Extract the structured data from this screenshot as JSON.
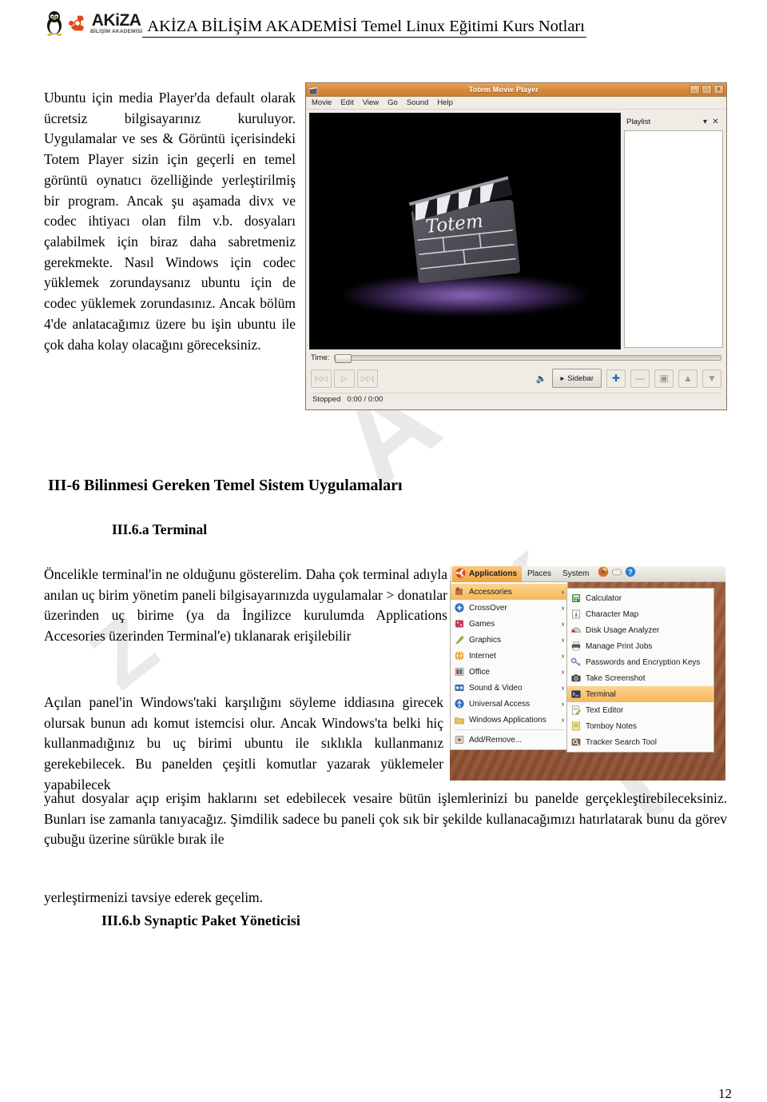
{
  "header": {
    "logo": {
      "tux_icon": "tux-penguin-icon",
      "ubuntu_icon": "ubuntu-logo-icon",
      "brand": "AKiZA",
      "brand_sub": "BİLİŞİM AKADEMİSİ"
    },
    "title": "AKİZA BİLİŞİM AKADEMİSİ Temel Linux Eğitimi Kurs Notları"
  },
  "intro_paragraph": "Ubuntu için media Player'da default olarak ücretsiz bilgisayarınız kuruluyor. Uygulamalar ve ses & Görüntü içerisindeki Totem Player sizin için geçerli en temel görüntü oynatıcı özelliğinde yerleştirilmiş bir program. Ancak şu aşamada divx ve codec ihtiyacı olan film v.b. dosyaları çalabilmek için biraz daha sabretmeniz gerekmekte. Nasıl Windows için codec yüklemek zorundaysanız ubuntu için de codec yüklemek zorundasınız. Ancak bölüm 4'de anlatacağımız üzere bu işin ubuntu ile çok daha kolay olacağını göreceksiniz.",
  "totem": {
    "window_title": "Totem Movie Player",
    "app_icon": "totem-app-icon",
    "window_buttons": [
      {
        "name": "minimize-button",
        "glyph": "_"
      },
      {
        "name": "maximize-button",
        "glyph": "□"
      },
      {
        "name": "close-button",
        "glyph": "x"
      }
    ],
    "menus": [
      "Movie",
      "Edit",
      "View",
      "Go",
      "Sound",
      "Help"
    ],
    "video_logo_text": "Totem",
    "playlist": {
      "title": "Playlist",
      "collapse_icon": "chevron-down-icon",
      "close_icon": "close-icon",
      "items": []
    },
    "time_label": "Time:",
    "controls": [
      {
        "name": "previous-button",
        "glyph": "|◁◁"
      },
      {
        "name": "play-button",
        "glyph": "▷"
      },
      {
        "name": "next-button",
        "glyph": "▷▷|"
      }
    ],
    "volume_icon": "volume-icon",
    "sidebar_button": "Sidebar",
    "playlist_buttons": [
      {
        "name": "add-to-playlist-button",
        "glyph": "✚"
      },
      {
        "name": "remove-from-playlist-button",
        "glyph": "—"
      },
      {
        "name": "copy-location-button",
        "glyph": "▣"
      },
      {
        "name": "move-up-button",
        "glyph": "▲"
      },
      {
        "name": "move-down-button",
        "glyph": "▼"
      }
    ],
    "status": "Stopped",
    "time_display": "0:00 / 0:00"
  },
  "section": {
    "heading": "III-6  Bilinmesi Gereken Temel Sistem Uygulamaları",
    "sub_heading_a": "III.6.a Terminal",
    "sub_heading_b": "III.6.b Synaptic Paket Yöneticisi"
  },
  "paragraphs": {
    "a": "Öncelikle terminal'in ne olduğunu gösterelim. Daha çok terminal adıyla anılan uç birim yönetim paneli bilgisayarınızda uygulamalar > donatılar üzerinden uç birime (ya da İngilizce kurulumda Applications Accesories üzerinden Terminal'e) tıklanarak erişilebilir",
    "b": "Açılan panel'in Windows'taki karşılığını söyleme iddiasına girecek olursak bunun adı komut istemcisi olur. Ancak Windows'ta belki hiç kullanmadığınız bu uç birimi ubuntu ile sıklıkla kullanmanız gerekebilecek. Bu panelden çeşitli komutlar yazarak yüklemeler yapabilecek",
    "c": "yahut dosyalar açıp erişim haklarını set edebilecek vesaire bütün işlemlerinizi bu panelde gerçekleştirebileceksiniz. Bunları ise zamanla tanıyacağız. Şimdilik sadece bu paneli çok sık bir şekilde kullanacağımızı hatırlatarak bunu da görev çubuğu üzerine sürükle bırak ile",
    "d": "yerleştirmenizi tavsiye ederek geçelim."
  },
  "gnome_menu": {
    "panel": {
      "applications": "Applications",
      "places": "Places",
      "system": "System",
      "icons": [
        "firefox-icon",
        "update-manager-icon",
        "help-icon"
      ]
    },
    "left_items": [
      {
        "label": "Accessories",
        "icon": "accessories-icon",
        "arrow": "›",
        "selected": true
      },
      {
        "label": "CrossOver",
        "icon": "crossover-icon",
        "arrow": "›",
        "selected": false
      },
      {
        "label": "Games",
        "icon": "games-icon",
        "arrow": "›",
        "selected": false
      },
      {
        "label": "Graphics",
        "icon": "graphics-icon",
        "arrow": "›",
        "selected": false
      },
      {
        "label": "Internet",
        "icon": "internet-icon",
        "arrow": "›",
        "selected": false
      },
      {
        "label": "Office",
        "icon": "office-icon",
        "arrow": "›",
        "selected": false
      },
      {
        "label": "Sound & Video",
        "icon": "sound-video-icon",
        "arrow": "›",
        "selected": false
      },
      {
        "label": "Universal Access",
        "icon": "universal-access-icon",
        "arrow": "›",
        "selected": false
      },
      {
        "label": "Windows Applications",
        "icon": "windows-applications-icon",
        "arrow": "›",
        "selected": false
      },
      {
        "label": "Add/Remove...",
        "icon": "add-remove-icon",
        "arrow": "",
        "selected": false
      }
    ],
    "right_items": [
      {
        "label": "Calculator",
        "icon": "calculator-icon",
        "selected": false
      },
      {
        "label": "Character Map",
        "icon": "character-map-icon",
        "selected": false
      },
      {
        "label": "Disk Usage Analyzer",
        "icon": "disk-usage-analyzer-icon",
        "selected": false
      },
      {
        "label": "Manage Print Jobs",
        "icon": "printer-icon",
        "selected": false
      },
      {
        "label": "Passwords and Encryption Keys",
        "icon": "keys-icon",
        "selected": false
      },
      {
        "label": "Take Screenshot",
        "icon": "camera-icon",
        "selected": false
      },
      {
        "label": "Terminal",
        "icon": "terminal-icon",
        "selected": true
      },
      {
        "label": "Text Editor",
        "icon": "text-editor-icon",
        "selected": false
      },
      {
        "label": "Tomboy Notes",
        "icon": "tomboy-icon",
        "selected": false
      },
      {
        "label": "Tracker Search Tool",
        "icon": "tracker-search-icon",
        "selected": false
      }
    ]
  },
  "page_number": "12",
  "colors": {
    "accent_orange": "#f0a33e",
    "titlebar_orange": "#d98b3e",
    "selection": "#f6b85a",
    "desktop": "#9c5a3c"
  }
}
